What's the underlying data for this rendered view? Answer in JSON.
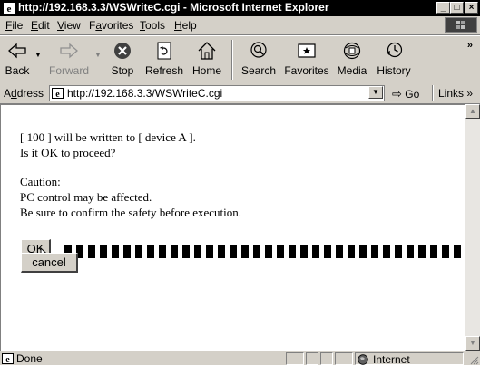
{
  "window": {
    "title": "http://192.168.3.3/WSWriteC.cgi - Microsoft Internet Explorer",
    "minimize": "_",
    "maximize": "□",
    "close": "×"
  },
  "menu": [
    {
      "pre": "",
      "key": "F",
      "post": "ile"
    },
    {
      "pre": "",
      "key": "E",
      "post": "dit"
    },
    {
      "pre": "",
      "key": "V",
      "post": "iew"
    },
    {
      "pre": "F",
      "key": "a",
      "post": "vorites"
    },
    {
      "pre": "",
      "key": "T",
      "post": "ools"
    },
    {
      "pre": "",
      "key": "H",
      "post": "elp"
    }
  ],
  "toolbar": {
    "back": "Back",
    "forward": "Forward",
    "stop": "Stop",
    "refresh": "Refresh",
    "home": "Home",
    "search": "Search",
    "favorites": "Favorites",
    "media": "Media",
    "history": "History",
    "more": "»"
  },
  "address": {
    "label_pre": "A",
    "label_key": "d",
    "label_post": "dress",
    "url": "http://192.168.3.3/WSWriteC.cgi",
    "go": "Go",
    "links": "Links »"
  },
  "content": {
    "line1": "[ 100 ] will be written to [ device A ].",
    "line2": "Is it OK to proceed?",
    "caution_title": "Caution:",
    "caution1": "PC control may be affected.",
    "caution2": "Be sure to confirm the safety before execution.",
    "ok_button": "OK",
    "cancel_button": "cancel"
  },
  "status": {
    "text": "Done",
    "zone": "Internet"
  },
  "colors": {
    "chrome": "#d4d0c8",
    "titlebar": "#000000",
    "content_bg": "#ffffff"
  }
}
